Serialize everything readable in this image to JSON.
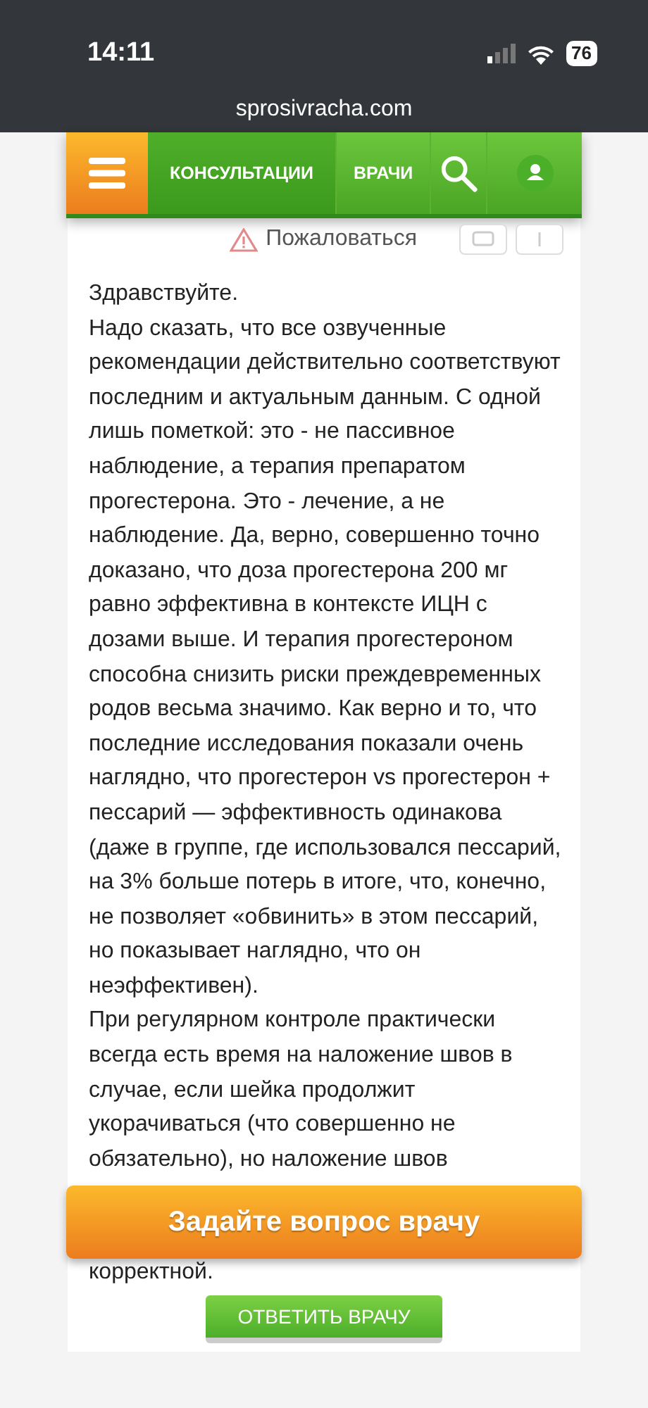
{
  "status_bar": {
    "time": "14:11",
    "battery": "76"
  },
  "browser": {
    "url": "sprosivracha.com"
  },
  "nav": {
    "items": [
      {
        "label": "КОНСУЛЬТАЦИИ",
        "selected": true
      },
      {
        "label": "ВРАЧИ",
        "selected": false
      }
    ]
  },
  "complain": {
    "label": "Пожаловаться"
  },
  "answer": {
    "paragraphs": [
      "Здравствуйте.",
      "Надо сказать, что все озвученные рекомендации действительно соответствуют последним и актуальным данным. С одной лишь пометкой: это - не пассивное наблюдение, а терапия препаратом прогестерона. Это - лечение, а не наблюдение. Да, верно, совершенно точно доказано, что доза прогестерона 200 мг равно эффективна в контексте ИЦН с дозами выше. И терапия прогестероном способна снизить риски преждевременных родов весьма значимо. Как верно и то, что последние исследования показали очень наглядно, что прогестерон vs прогестерон + пессарий — эффективность одинакова (даже в группе, где использовался пессарий, на 3% больше потерь в итоге, что, конечно, не позволяет «обвинить» в этом пессарий, но показывает наглядно, что он неэффективен).",
      "При регулярном контроле практически всегда есть время на наложение швов в случае, если шейка продолжит укорачиваться (что совершенно не обязательно), но наложение швов"
    ],
    "tail": "корректной."
  },
  "ask_button": "Задайте вопрос врачу",
  "reply_button": "ОТВЕТИТЬ ВРАЧУ"
}
